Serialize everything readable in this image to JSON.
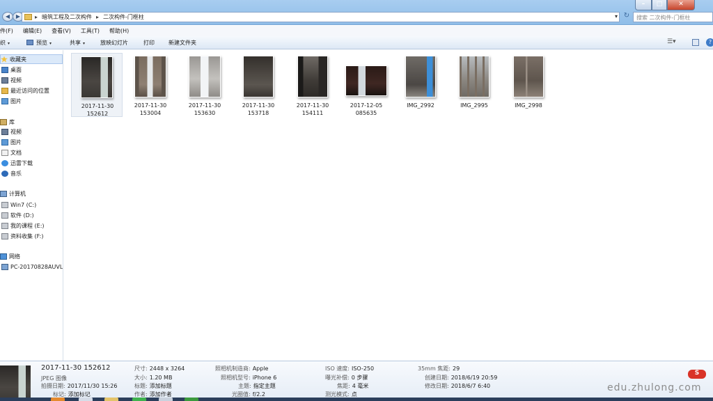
{
  "address": {
    "crumbs": [
      "暗筑工程及二次构件",
      "二次构件-门框柱"
    ],
    "search_placeholder": "搜索 二次构件-门框柱"
  },
  "menu": [
    "件(F)",
    "编辑(E)",
    "查看(V)",
    "工具(T)",
    "帮助(H)"
  ],
  "toolbar": {
    "organize": "织",
    "preview": "预览",
    "share": "共享",
    "slideshow": "放映幻灯片",
    "print": "打印",
    "new_folder": "新建文件夹"
  },
  "sidebar": {
    "favorites": {
      "header": "收藏夹",
      "items": [
        "桌面",
        "视频",
        "最近访问的位置",
        "图片"
      ]
    },
    "libraries": {
      "header": "库",
      "items": [
        "视频",
        "图片",
        "文档",
        "迅雷下载",
        "音乐"
      ]
    },
    "computer": {
      "header": "计算机",
      "items": [
        "Win7 (C:)",
        "软件 (D:)",
        "我的课程 (E:)",
        "资料收集 (F:)"
      ]
    },
    "network": {
      "header": "网络",
      "items": [
        "PC-20170828AUVL"
      ]
    }
  },
  "files": [
    {
      "line1": "2017-11-30",
      "line2": "152612",
      "selected": true
    },
    {
      "line1": "2017-11-30",
      "line2": "153004"
    },
    {
      "line1": "2017-11-30",
      "line2": "153630"
    },
    {
      "line1": "2017-11-30",
      "line2": "153718"
    },
    {
      "line1": "2017-11-30",
      "line2": "154111"
    },
    {
      "line1": "2017-12-05",
      "line2": "085635"
    },
    {
      "line1": "IMG_2992",
      "line2": ""
    },
    {
      "line1": "IMG_2995",
      "line2": ""
    },
    {
      "line1": "IMG_2998",
      "line2": ""
    }
  ],
  "details": {
    "title": "2017-11-30 152612",
    "type": "JPEG 图像",
    "fields": {
      "taken_label": "拍摄日期:",
      "taken_value": "2017/11/30 15:26",
      "tags_label": "标记:",
      "tags_value": "添加标记",
      "dims_label": "尺寸:",
      "dims_value": "2448 x 3264",
      "size_label": "大小:",
      "size_value": "1.20 MB",
      "title_label": "标题:",
      "title_value": "添加标题",
      "author_label": "作者:",
      "author_value": "添加作者",
      "maker_label": "照相机制造商:",
      "maker_value": "Apple",
      "model_label": "照相机型号:",
      "model_value": "iPhone 6",
      "subject_label": "主题:",
      "subject_value": "指定主题",
      "aperture_label": "光圈值:",
      "aperture_value": "f/2.2",
      "iso_label": "ISO 速度:",
      "iso_value": "ISO-250",
      "exposure_label": "曝光补偿:",
      "exposure_value": "0 步骤",
      "focal_label": "焦距:",
      "focal_value": "4 毫米",
      "metering_label": "测光模式:",
      "metering_value": "点",
      "f35_label": "35mm 焦距:",
      "f35_value": "29",
      "created_label": "创建日期:",
      "created_value": "2018/6/19 20:59",
      "modified_label": "修改日期:",
      "modified_value": "2018/6/7 6:40"
    }
  },
  "watermark": {
    "text": "edu.zhulong.com",
    "logo": "S"
  }
}
